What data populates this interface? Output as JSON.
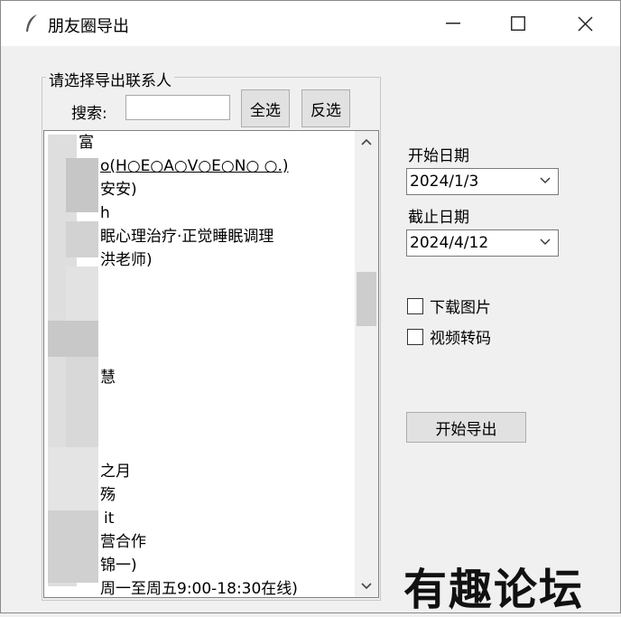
{
  "window": {
    "title": "朋友圈导出"
  },
  "contacts_group": {
    "legend": "请选择导出联系人",
    "search_label": "搜索:",
    "search_value": "",
    "select_all_label": "全选",
    "invert_label": "反选",
    "items": [
      "富",
      "o(H○E○A○V○E○N○ ○.)",
      "安安)",
      "h",
      "眠心理治疗·正觉睡眠调理",
      "洪老师)",
      "",
      "",
      "",
      "",
      "慧",
      "",
      "",
      "",
      "之月",
      "殇",
      "it",
      "营合作",
      "锦一)",
      "周一至周五9:00-18:30在线)"
    ]
  },
  "date_panel": {
    "start_label": "开始日期",
    "start_value": "2024/1/3",
    "end_label": "截止日期",
    "end_value": "2024/4/12"
  },
  "options": {
    "download_images_label": "下载图片",
    "download_images_checked": false,
    "video_transcode_label": "视频转码",
    "video_transcode_checked": false
  },
  "export_button_label": "开始导出",
  "watermark": "有趣论坛"
}
